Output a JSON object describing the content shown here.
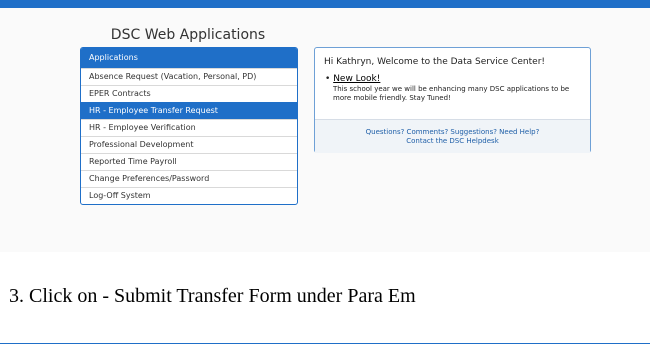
{
  "app": {
    "title": "DSC Web Applications"
  },
  "applications": {
    "header": "Applications",
    "items": [
      "Absence Request (Vacation, Personal, PD)",
      "EPER Contracts",
      "HR - Employee Transfer Request",
      "HR - Employee Verification",
      "Professional Development",
      "Reported Time Payroll",
      "Change Preferences/Password",
      "Log-Off System"
    ],
    "active_item": "HR - Employee Transfer Request"
  },
  "welcome": {
    "greeting": "Hi Kathryn, Welcome to the Data Service Center!",
    "news_title": "New Look!",
    "news_text": "This school year we will be enhancing many DSC applications to be more mobile friendly. Stay Tuned!",
    "help_line": "Questions? Comments? Suggestions? Need Help?",
    "help_link": "Contact the DSC Helpdesk"
  },
  "instruction": "3. Click on - Submit Transfer Form under Para Em",
  "colors": {
    "accent": "#1f6fc8",
    "link": "#1f5fa8"
  }
}
